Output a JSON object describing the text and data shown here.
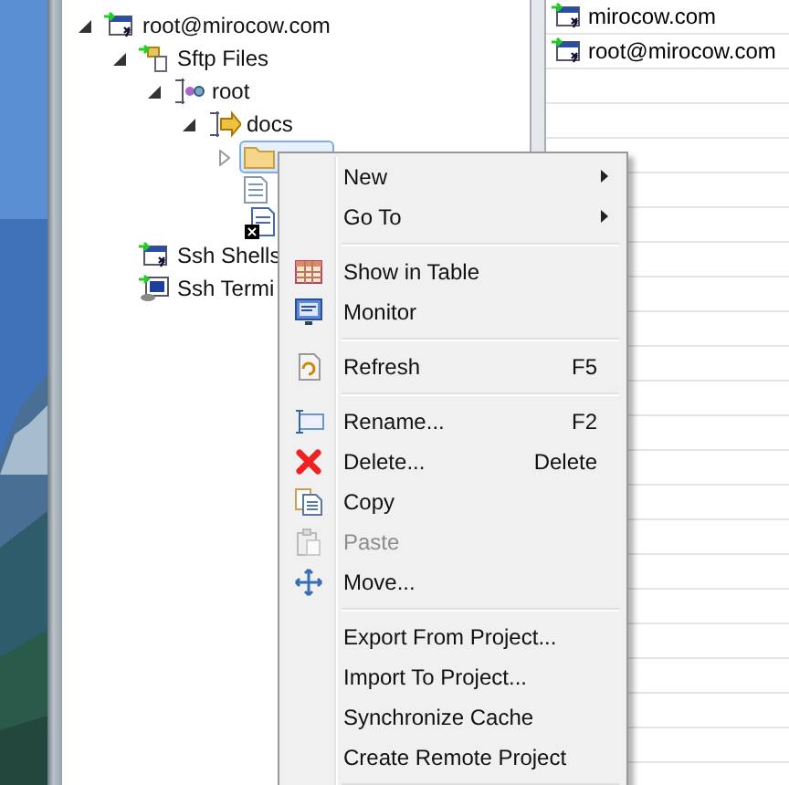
{
  "tree": [
    {
      "label": "root@mirocow.com",
      "kind": "connection",
      "expanded": true,
      "selected": false,
      "children": [
        {
          "label": "Sftp Files",
          "kind": "sftp",
          "expanded": true,
          "selected": false,
          "children": [
            {
              "label": "root",
              "kind": "root",
              "expanded": true,
              "selected": false,
              "children": [
                {
                  "label": "docs",
                  "kind": "docs",
                  "expanded": true,
                  "selected": false,
                  "children": [
                    {
                      "kind": "folder",
                      "expanded": false,
                      "selected": true
                    },
                    {
                      "kind": "file",
                      "selected": false
                    },
                    {
                      "kind": "excel",
                      "selected": false
                    }
                  ]
                }
              ]
            }
          ]
        },
        {
          "label": "Ssh Shells",
          "kind": "connection",
          "selected": false
        },
        {
          "label": "Ssh Termi",
          "kind": "terminal",
          "selected": false
        }
      ]
    }
  ],
  "side_table": {
    "rows": [
      {
        "label": "mirocow.com"
      },
      {
        "label": "root@mirocow.com"
      }
    ]
  },
  "context_menu": [
    {
      "kind": "item",
      "label": "New",
      "submenu": true,
      "disabled": false
    },
    {
      "kind": "item",
      "label": "Go To",
      "submenu": true,
      "disabled": false
    },
    {
      "kind": "separator"
    },
    {
      "kind": "table",
      "label": "Show in Table",
      "disabled": false
    },
    {
      "kind": "monitor",
      "label": "Monitor",
      "disabled": false
    },
    {
      "kind": "separator"
    },
    {
      "kind": "refresh",
      "label": "Refresh",
      "shortcut": "F5",
      "disabled": false
    },
    {
      "kind": "separator"
    },
    {
      "kind": "rename",
      "label": "Rename...",
      "shortcut": "F2",
      "disabled": false
    },
    {
      "kind": "delete",
      "label": "Delete...",
      "shortcut": "Delete",
      "disabled": false
    },
    {
      "kind": "copy",
      "label": "Copy",
      "disabled": false
    },
    {
      "kind": "paste",
      "label": "Paste",
      "disabled": true
    },
    {
      "kind": "move",
      "label": "Move...",
      "disabled": false
    },
    {
      "kind": "separator"
    },
    {
      "kind": "item",
      "label": "Export From Project...",
      "disabled": false
    },
    {
      "kind": "item",
      "label": "Import To Project...",
      "disabled": false
    },
    {
      "kind": "item",
      "label": "Synchronize Cache",
      "disabled": false
    },
    {
      "kind": "item",
      "label": "Create Remote Project",
      "disabled": false
    },
    {
      "kind": "separator"
    }
  ]
}
